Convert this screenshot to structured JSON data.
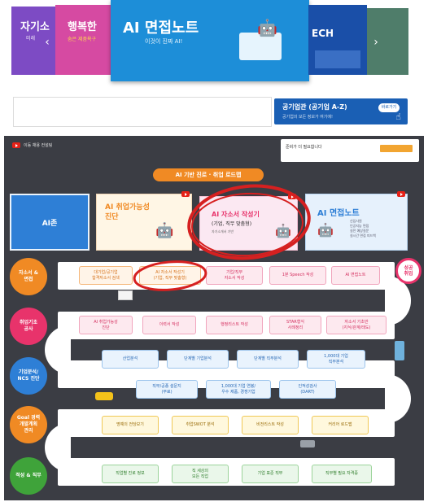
{
  "carousel": {
    "slide1": {
      "title": "자기소",
      "sub": "미래"
    },
    "slide2": {
      "title": "행복한",
      "sub": "숨은 제품욕구"
    },
    "slide3": {
      "title": "AI 면접노트",
      "sub": "이것이 진짜 AI!"
    },
    "slide4": {
      "title": "ECH"
    },
    "prev": "‹",
    "next": "›"
  },
  "open_button": {
    "label": "공기업관 (공기업 A-Z)",
    "sub": "공기업의 모든 정보가 여기에!",
    "shortcut": "바로가기"
  },
  "board": {
    "header": "이동 채용 컨설팅",
    "notice": "준비가 더 필요합니다",
    "badge": "AI 기반 진로 · 취업 로드맵",
    "zone": "AI존",
    "card1": {
      "title": "AI 취업가능성\n진단"
    },
    "card2": {
      "title": "AI 자소서 작성기",
      "sub": "(기업, 직무 맞춤형)",
      "desc": "자기소개서 기반"
    },
    "card3": {
      "title": "AI 면접노트",
      "desc": "신입사원\n인공지능 면접\n실전 예상질문\n실시간 면접 피드백"
    },
    "goal": "성공\n취업",
    "rows": [
      {
        "label": "자소서 &\n면접",
        "steps": [
          "대기업/공기업\n합격자소서 검색",
          "AI 자소서 작성기\n(기업, 직무 맞춤형)",
          "기업/직무\n자소서 작성",
          "1분 Speech 작성",
          "AI 면접노트"
        ]
      },
      {
        "label": "취업기초\n공사",
        "steps": [
          "AI 취업가능성\n진단",
          "이력서 작성",
          "행정리스트 작성",
          "STAR형식\n사례정리",
          "자소서 기초반\n(지식/관계/태도)"
        ]
      },
      {
        "label": "기업분석/\nNCS 진단",
        "steps": [
          "산업분석",
          "단계별 기업분석",
          "단계별 직무분석",
          "1,000대 기업\n직무분석"
        ]
      },
      {
        "label": "",
        "steps": [
          "직무/공종 설문지\n(무료)",
          "1,000대 기업 연봉/\n우수 제품, 경쟁기업",
          "인적성검사\n(DART)"
        ]
      },
      {
        "label": "Goal 경력\n개발계획\n관리",
        "steps": [
          "명예의 전당보기",
          "취업SWOT 분석",
          "비전리스트 작성",
          "커리어 로드맵"
        ]
      },
      {
        "label": "적성 & 직무",
        "steps": [
          "직업별 진로 정보",
          "직 세상의\n모든 직업",
          "기업 표준 직무",
          "직무별 필요 자격증"
        ]
      }
    ]
  },
  "colors": {
    "accent_orange": "#f08a24",
    "accent_blue": "#2e7fd6",
    "accent_pink": "#e8336b",
    "highlight_red": "#d62020",
    "board_bg": "#3b3d44"
  }
}
